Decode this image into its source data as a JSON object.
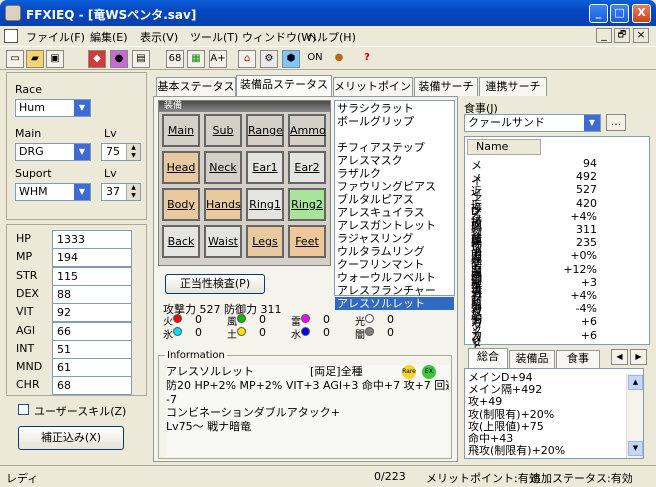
{
  "window": {
    "title": "FFXIEQ - [竜WSペンタ.sav]",
    "min": "_",
    "max": "□",
    "close": "X"
  },
  "menu": [
    "ファイル(F)",
    "編集(E)",
    "表示(V)",
    "ツール(T)",
    "ウィンドウ(W)",
    "ヘルプ(H)"
  ],
  "mdi": {
    "min": "_",
    "restore": "🗗",
    "close": "×"
  },
  "toolbar": {
    "labels": [
      "68",
      "",
      "A+",
      "",
      "",
      "",
      "",
      "ON",
      "",
      "?"
    ]
  },
  "left": {
    "race_label": "Race",
    "race": "Hum",
    "main_label": "Main",
    "main": "DRG",
    "lv_label": "Lv",
    "main_lv": "75",
    "sup_label": "Suport",
    "sup": "WHM",
    "sup_lv_label": "Lv",
    "sup_lv": "37",
    "stats": [
      {
        "name": "HP",
        "value": "1333"
      },
      {
        "name": "MP",
        "value": "194"
      },
      {
        "name": "STR",
        "value": "115"
      },
      {
        "name": "DEX",
        "value": "88"
      },
      {
        "name": "VIT",
        "value": "92"
      },
      {
        "name": "AGI",
        "value": "66"
      },
      {
        "name": "INT",
        "value": "51"
      },
      {
        "name": "MND",
        "value": "61"
      },
      {
        "name": "CHR",
        "value": "68"
      }
    ],
    "user_skill": "ユーザースキル(Z)",
    "correction": "補正込み(X)"
  },
  "tabs": [
    "基本ステータス",
    "装備品ステータス",
    "メリットポイント",
    "装備サーチ",
    "連携サーチ"
  ],
  "equip": {
    "header": "装備",
    "slots": [
      [
        "Main",
        "Sub",
        "Range",
        "Ammo"
      ],
      [
        "Head",
        "Neck",
        "Ear1",
        "Ear2"
      ],
      [
        "Body",
        "Hands",
        "Ring1",
        "Ring2"
      ],
      [
        "Back",
        "Waist",
        "Legs",
        "Feet"
      ]
    ],
    "validate": "正当性検査(P)",
    "atk_def": "攻撃力 527 防御力 311",
    "elements": [
      {
        "name": "火",
        "value": "0",
        "color": "#ff0000"
      },
      {
        "name": "風",
        "value": "0",
        "color": "#00c000"
      },
      {
        "name": "雷",
        "value": "0",
        "color": "#ff00ff"
      },
      {
        "name": "光",
        "value": "0",
        "color": "#ffffff"
      },
      {
        "name": "氷",
        "value": "0",
        "color": "#00e0ff"
      },
      {
        "name": "土",
        "value": "0",
        "color": "#ffe000"
      },
      {
        "name": "水",
        "value": "0",
        "color": "#0000ff"
      },
      {
        "name": "闇",
        "value": "0",
        "color": "#808080"
      }
    ],
    "info_label": "Information",
    "info_name": "アレスソルレット",
    "info_tag": "[両足]全種",
    "info_line1": "防20 HP+2% MP+2% VIT+3 AGI+3 命中+7 攻+7 回避",
    "info_line2": "-7",
    "info_line3": "コンビネーションダブルアタック+",
    "info_line4": "Lv75～ 戦ナ暗竜"
  },
  "items": [
    "サラシクラット",
    "ボールグリップ",
    "",
    "チフィアステップ",
    "アレスマスク",
    "ラザルク",
    "ファウリングピアス",
    "ブルタルピアス",
    "アレスキュイラス",
    "アレスガントレット",
    "ラジャスリング",
    "ウルタラムリング",
    "クーフリンマント",
    "ウォーウルフベルト",
    "アレスフランチャー",
    "アレスソルレット"
  ],
  "food": {
    "label": "食事(J)",
    "value": "クァールサンド",
    "btn": "..."
  },
  "food_table": {
    "header": "Name",
    "rows": [
      [
        "メインD",
        "94"
      ],
      [
        "メイン間隔",
        "492"
      ],
      [
        "近接攻撃力",
        "527"
      ],
      [
        "近接命中力",
        "420"
      ],
      [
        "クリット率",
        "+4%"
      ],
      [
        "物理防御力",
        "311"
      ],
      [
        "物理回避力",
        "235"
      ],
      [
        "魔法攻撃力",
        "+0%"
      ],
      [
        "魔法防御力",
        "+12%"
      ],
      [
        "敵対心",
        "+3"
      ],
      [
        "クリット率",
        "+4%"
      ],
      [
        "被クリット率",
        "-4%"
      ],
      [
        "モクシャ",
        "+6"
      ],
      [
        "ストアTP",
        "+6"
      ]
    ]
  },
  "bottom_tabs": [
    "総合",
    "装備品",
    "食事"
  ],
  "summary": [
    "メインD+94",
    "メイン隔+492",
    "攻+49",
    "攻(制限有)+20%",
    "攻(上限値)+75",
    "命中+43",
    "飛攻(制限有)+20%"
  ],
  "status": {
    "left": "レディ",
    "count": "0/223",
    "merit": "メリットポイント:有効",
    "extra": "追加ステータス:有効"
  }
}
